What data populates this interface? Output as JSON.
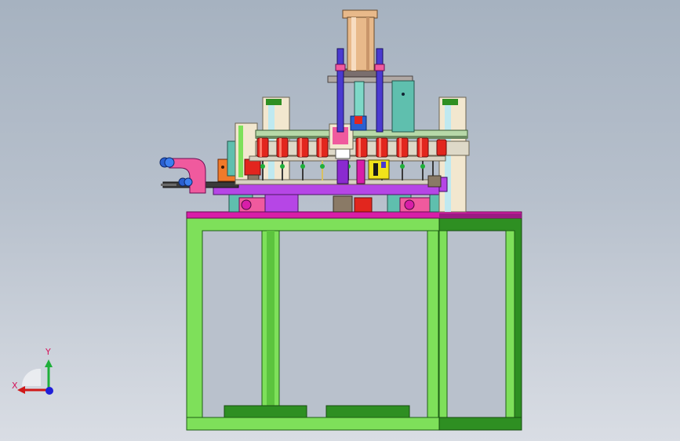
{
  "viewport": {
    "background_top": "#a6b2c0",
    "background_bottom": "#d9dde4"
  },
  "model": {
    "colors": {
      "frame": "#7ee05a",
      "frame_dark": "#2e8f22",
      "plate_purple": "#b646e6",
      "plate_magenta": "#d81ea8",
      "cylinder_bronze": "#e8b98a",
      "roller_red": "#e2261e",
      "pillar_cream": "#f2e7cf",
      "post_blue": "#4a3ad0",
      "accent_teal": "#5fbfae",
      "accent_pink": "#f05a9e"
    },
    "roller_count": 9,
    "spring_count": 10
  },
  "triad": {
    "x_label": "X",
    "y_label": "Y",
    "z_color": "#1f1fd8",
    "x_color": "#d01818",
    "y_color": "#1faf3a"
  }
}
